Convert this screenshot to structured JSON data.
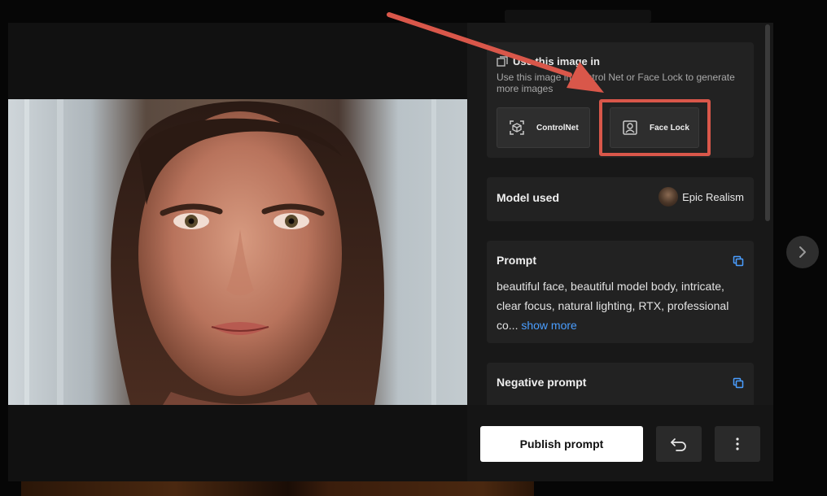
{
  "use_image": {
    "title": "Use this image in",
    "description": "Use this image in Control Net or Face Lock to generate more images",
    "buttons": [
      {
        "label": "ControlNet",
        "icon": "controlnet-icon"
      },
      {
        "label": "Face Lock",
        "icon": "face-lock-icon"
      }
    ]
  },
  "model": {
    "label": "Model used",
    "name": "Epic Realism"
  },
  "prompt": {
    "label": "Prompt",
    "text": "beautiful face, beautiful model body, intricate, clear focus, natural lighting, RTX, professional co...",
    "show_more": "show more"
  },
  "negative_prompt": {
    "label": "Negative prompt"
  },
  "footer": {
    "publish_label": "Publish prompt",
    "undo_icon": "undo-icon",
    "more_icon": "more-vertical-icon"
  },
  "nav": {
    "next_icon": "chevron-right-icon"
  },
  "colors": {
    "highlight": "#d9574a",
    "link": "#4a9eff",
    "panel_bg": "#181818",
    "card_bg": "#222222"
  }
}
